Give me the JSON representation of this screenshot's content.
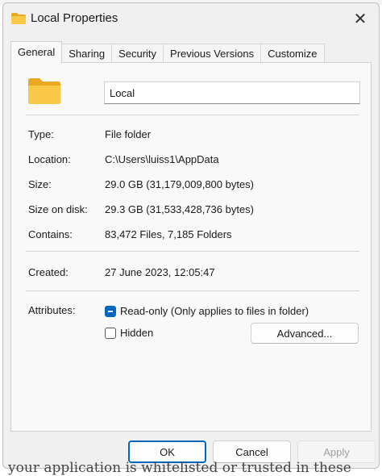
{
  "background": {
    "bottom_text": "your application is whitelisted or trusted in these"
  },
  "dialog": {
    "title": "Local Properties",
    "close_glyph": "✕",
    "tabs": [
      {
        "label": "General",
        "active": true
      },
      {
        "label": "Sharing",
        "active": false
      },
      {
        "label": "Security",
        "active": false
      },
      {
        "label": "Previous Versions",
        "active": false
      },
      {
        "label": "Customize",
        "active": false
      }
    ],
    "folder_name": "Local",
    "properties": {
      "type_label": "Type:",
      "type_value": "File folder",
      "location_label": "Location:",
      "location_value": "C:\\Users\\luiss1\\AppData",
      "size_label": "Size:",
      "size_value": "29.0 GB (31,179,009,800 bytes)",
      "size_on_disk_label": "Size on disk:",
      "size_on_disk_value": "29.3 GB (31,533,428,736 bytes)",
      "contains_label": "Contains:",
      "contains_value": "83,472 Files, 7,185 Folders",
      "created_label": "Created:",
      "created_value": "27 June 2023, 12:05:47"
    },
    "attributes": {
      "label": "Attributes:",
      "readonly_label": "Read-only (Only applies to files in folder)",
      "readonly_state": "indeterminate",
      "hidden_label": "Hidden",
      "hidden_state": "unchecked",
      "advanced_label": "Advanced..."
    },
    "buttons": {
      "ok": "OK",
      "cancel": "Cancel",
      "apply": "Apply"
    }
  },
  "colors": {
    "accent": "#0067c0",
    "folder": "#f8c846",
    "folder_dark": "#e8a920"
  },
  "icons": {
    "title_icon": "folder-icon",
    "big_icon": "folder-icon",
    "close": "close-icon"
  }
}
